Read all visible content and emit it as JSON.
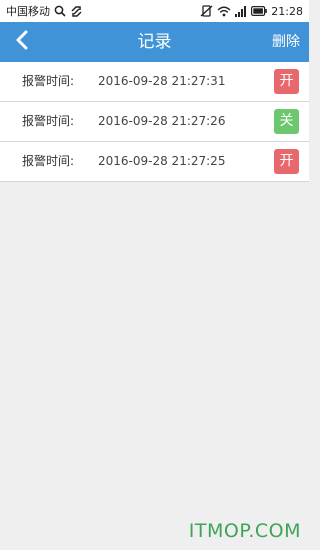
{
  "status_bar": {
    "carrier": "中国移动",
    "time": "21:28",
    "icons": [
      "search-icon",
      "link-icon",
      "vibrate-off-icon",
      "wifi-icon",
      "signal-icon",
      "battery-icon"
    ]
  },
  "header": {
    "title": "记录",
    "back_icon": "chevron-left-icon",
    "delete_label": "删除"
  },
  "records": [
    {
      "label": "报警时间:",
      "time": "2016-09-28 21:27:31",
      "state": "开"
    },
    {
      "label": "报警时间:",
      "time": "2016-09-28 21:27:26",
      "state": "关"
    },
    {
      "label": "报警时间:",
      "time": "2016-09-28 21:27:25",
      "state": "开"
    }
  ],
  "colors": {
    "header_bg": "#4093d6",
    "open_badge": "#e8686e",
    "closed_badge": "#6cc76e"
  },
  "watermark": "ITMOP.COM"
}
